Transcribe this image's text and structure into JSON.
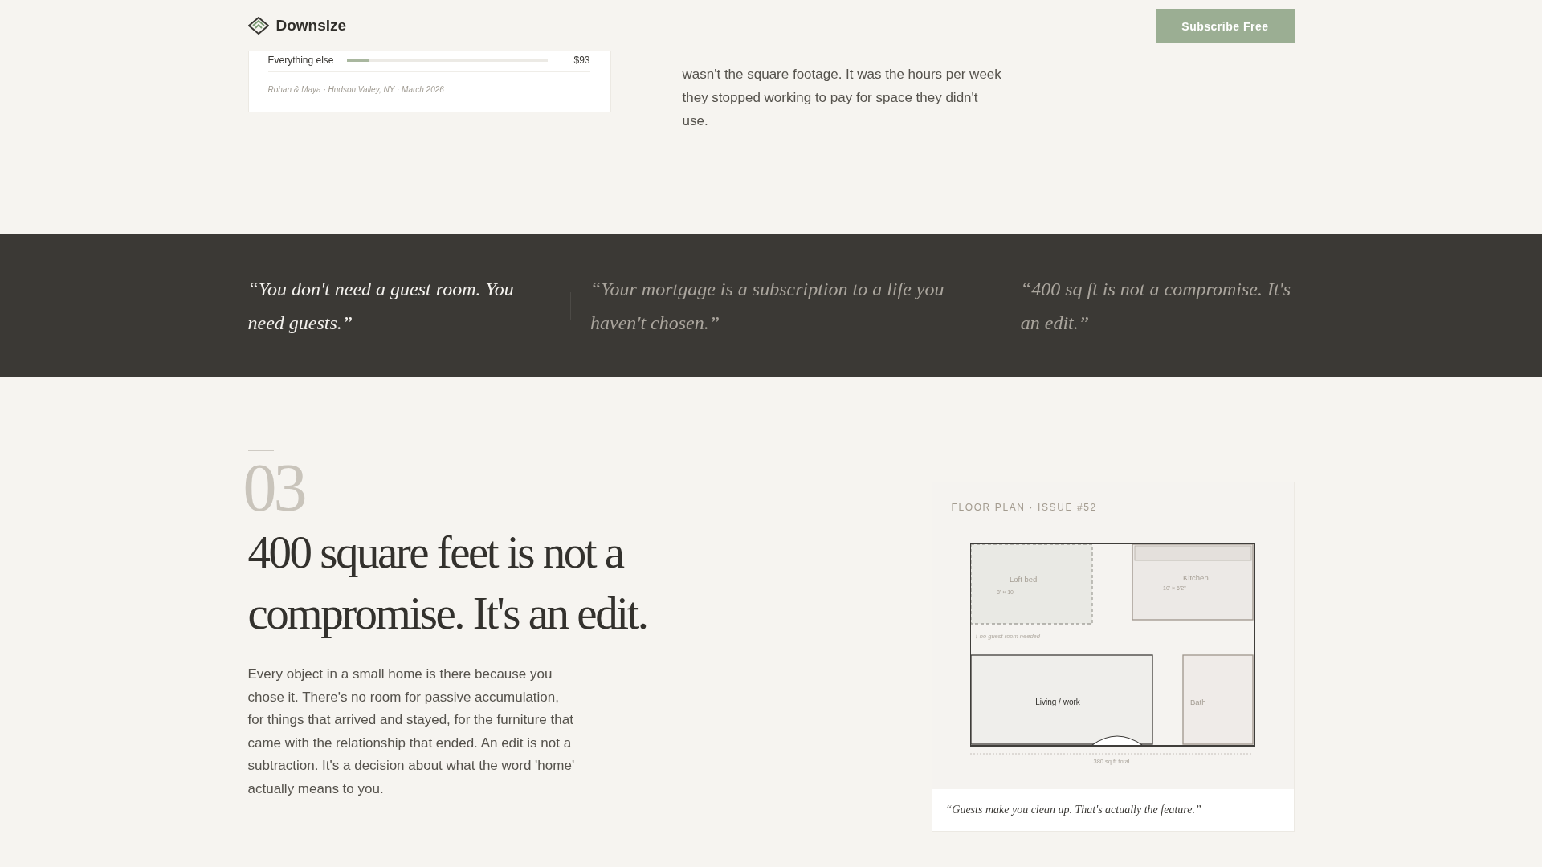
{
  "header": {
    "brand": "Downsize",
    "button": "Subscribe Free"
  },
  "story": {
    "card": {
      "rows": [
        {
          "label": "Everything else",
          "level": 0.11,
          "value": "$93"
        }
      ],
      "caption": "Rohan & Maya · Hudson Valley, NY · March 2026"
    },
    "paragraph": "wasn't the square footage. It was the hours per week they stopped working to pay for space they didn't use."
  },
  "quotes": [
    {
      "text": "“You don't need a guest room. You need guests.”",
      "selected": true
    },
    {
      "text": "“Your mortgage is a subscription to a life you haven't chosen.”",
      "selected": false
    },
    {
      "text": "“400 sq ft is not a compromise. It's an edit.”",
      "selected": false
    }
  ],
  "section": {
    "number": "03",
    "heading": "400 square feet is not a compromise. It's an edit.",
    "body": "Every object in a small home is there because you chose it. There's no room for passive accumulation, for things that arrived and stayed, for the furniture that came with the relationship that ended. An edit is not a subtraction. It's a decision about what the word 'home' actually means to you."
  },
  "floor_plan": {
    "label": "FLOOR PLAN · ISSUE #52",
    "rooms": [
      {
        "kind": "loft",
        "name": "Loft bed",
        "size": "8' × 10'"
      },
      {
        "kind": "kitchen",
        "name": "Kitchen",
        "size": "10' × 6'2\""
      },
      {
        "kind": "living",
        "name": "Living / work"
      },
      {
        "kind": "bath",
        "name": "Bath"
      }
    ],
    "note": "↓ no guest room needed",
    "total": "380 sq ft total",
    "caption": "“Guests make you clean up. That's actually the feature.”"
  }
}
